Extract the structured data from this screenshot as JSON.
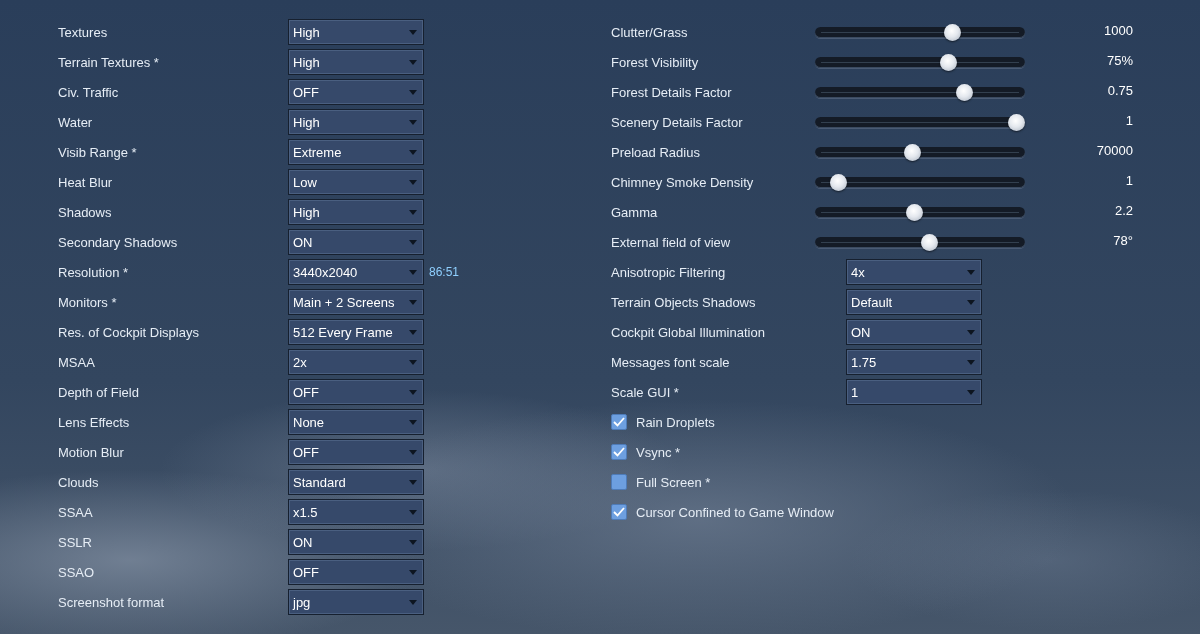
{
  "left_settings": [
    {
      "label": "Textures",
      "value": "High"
    },
    {
      "label": "Terrain Textures *",
      "value": "High"
    },
    {
      "label": "Civ. Traffic",
      "value": "OFF"
    },
    {
      "label": "Water",
      "value": "High"
    },
    {
      "label": "Visib Range *",
      "value": "Extreme"
    },
    {
      "label": "Heat Blur",
      "value": "Low"
    },
    {
      "label": "Shadows",
      "value": "High"
    },
    {
      "label": "Secondary Shadows",
      "value": "ON"
    },
    {
      "label": "Resolution *",
      "value": "3440x2040",
      "note": "86:51"
    },
    {
      "label": "Monitors *",
      "value": "Main + 2 Screens"
    },
    {
      "label": "Res. of Cockpit Displays",
      "value": "512 Every Frame"
    },
    {
      "label": "MSAA",
      "value": "2x"
    },
    {
      "label": "Depth of Field",
      "value": "OFF"
    },
    {
      "label": "Lens Effects",
      "value": "None"
    },
    {
      "label": "Motion Blur",
      "value": "OFF"
    },
    {
      "label": "Clouds",
      "value": "Standard"
    },
    {
      "label": "SSAA",
      "value": "x1.5"
    },
    {
      "label": "SSLR",
      "value": "ON"
    },
    {
      "label": "SSAO",
      "value": "OFF"
    },
    {
      "label": "Screenshot format",
      "value": "jpg"
    }
  ],
  "right_settings": [
    {
      "kind": "slider",
      "label": "Clutter/Grass",
      "level": 0.67,
      "reading": "1000"
    },
    {
      "kind": "slider",
      "label": "Forest Visibility",
      "level": 0.65,
      "reading": "75%"
    },
    {
      "kind": "slider",
      "label": "Forest Details Factor",
      "level": 0.73,
      "reading": "0.75"
    },
    {
      "kind": "slider",
      "label": "Scenery Details Factor",
      "level": 1,
      "reading": "1"
    },
    {
      "kind": "slider",
      "label": "Preload Radius",
      "level": 0.46,
      "reading": "70000"
    },
    {
      "kind": "slider",
      "label": "Chimney Smoke Density",
      "level": 0.08,
      "reading": "1"
    },
    {
      "kind": "slider",
      "label": "Gamma",
      "level": 0.47,
      "reading": "2.2"
    },
    {
      "kind": "slider",
      "label": "External field of view",
      "level": 0.55,
      "reading": "78°"
    },
    {
      "kind": "select",
      "label": "Anisotropic Filtering",
      "value": "4x"
    },
    {
      "kind": "select",
      "label": "Terrain Objects Shadows",
      "value": "Default"
    },
    {
      "kind": "select",
      "label": "Cockpit Global Illumination",
      "value": "ON"
    },
    {
      "kind": "select",
      "label": "Messages font scale",
      "value": "1.75"
    },
    {
      "kind": "select",
      "label": "Scale GUI *",
      "value": "1"
    },
    {
      "kind": "checkbox",
      "label": "Rain Droplets",
      "checked": true
    },
    {
      "kind": "checkbox",
      "label": "Vsync *",
      "checked": true
    },
    {
      "kind": "checkbox",
      "label": "Full Screen *",
      "checked": false
    },
    {
      "kind": "checkbox",
      "label": "Cursor Confined to Game Window",
      "checked": true
    }
  ]
}
